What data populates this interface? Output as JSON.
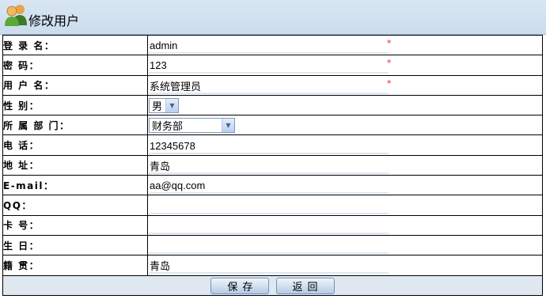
{
  "header": {
    "title": "修改用户",
    "icon": "users-icon"
  },
  "form": {
    "rows": [
      {
        "label": "登 录 名：",
        "value": "admin",
        "required": "*"
      },
      {
        "label": "密 码：",
        "value": "123",
        "required": "*"
      },
      {
        "label": "用 户 名：",
        "value": "系统管理员",
        "required": "*"
      },
      {
        "label": "性 别：",
        "select_value": "男"
      },
      {
        "label": "所 属 部 门：",
        "select_value": "财务部"
      },
      {
        "label": "电 话：",
        "value": "12345678"
      },
      {
        "label": "地 址：",
        "value": "青岛"
      },
      {
        "label": "E-mail：",
        "value": "aa@qq.com"
      },
      {
        "label": "QQ：",
        "value": ""
      },
      {
        "label": "卡 号：",
        "value": ""
      },
      {
        "label": "生 日：",
        "value": ""
      },
      {
        "label": "籍 贯：",
        "value": "青岛"
      }
    ]
  },
  "actions": {
    "save_label": "保存",
    "back_label": "返回"
  }
}
